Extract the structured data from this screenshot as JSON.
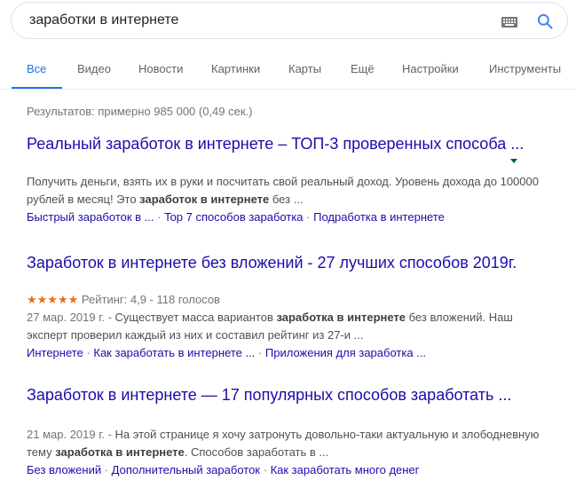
{
  "search": {
    "query": "заработки в интернете"
  },
  "tabs": [
    {
      "label": "Все",
      "active": true
    },
    {
      "label": "Видео"
    },
    {
      "label": "Новости"
    },
    {
      "label": "Картинки"
    },
    {
      "label": "Карты"
    },
    {
      "label": "Ещё"
    },
    {
      "label": "Настройки"
    },
    {
      "label": "Инструменты"
    }
  ],
  "stats": "Результатов: примерно 985 000 (0,49 сек.)",
  "results": [
    {
      "title": "Реальный заработок в интернете – ТОП-3 проверенных способа ...",
      "snippet_line1": "Получить деньги, взять их в руки и посчитать свой реальный доход. Уровень дохода до 100000",
      "snippet_line2_pre": "рублей в месяц! Это ",
      "snippet_line2_bold": "заработок в интернете",
      "snippet_line2_post": " без ...",
      "sitelinks": [
        "Быстрый заработок в ...",
        "Top 7 способов заработка",
        "Подработка в интернете"
      ]
    },
    {
      "title": "Заработок в интернете без вложений - 27 лучших способов 2019г.",
      "stars": "★★★★★",
      "rating": "Рейтинг: 4,9 - 118 голосов",
      "date": "27 мар. 2019 г. - ",
      "snippet_line1_pre": "Существует масса вариантов ",
      "snippet_line1_bold": "заработка в интернете",
      "snippet_line1_post": " без вложений. Наш",
      "snippet_line2": "эксперт проверил каждый из них и составил рейтинг из 27-и ...",
      "sitelinks": [
        "Интернете",
        "Как заработать в интернете ...",
        "Приложения для заработка ..."
      ]
    },
    {
      "title": "Заработок в интернете — 17 популярных способов заработать ...",
      "date": "21 мар. 2019 г. - ",
      "snippet_line1_post": "На этой странице я хочу затронуть довольно-таки актуальную и злободневную",
      "snippet_line2_pre": "тему ",
      "snippet_line2_bold": "заработка в интернете",
      "snippet_line2_post": ". Способов заработать в ...",
      "sitelinks": [
        "Без вложений",
        "Дополнительный заработок",
        "Как заработать много денег"
      ]
    }
  ],
  "sitelink_separator": " · "
}
